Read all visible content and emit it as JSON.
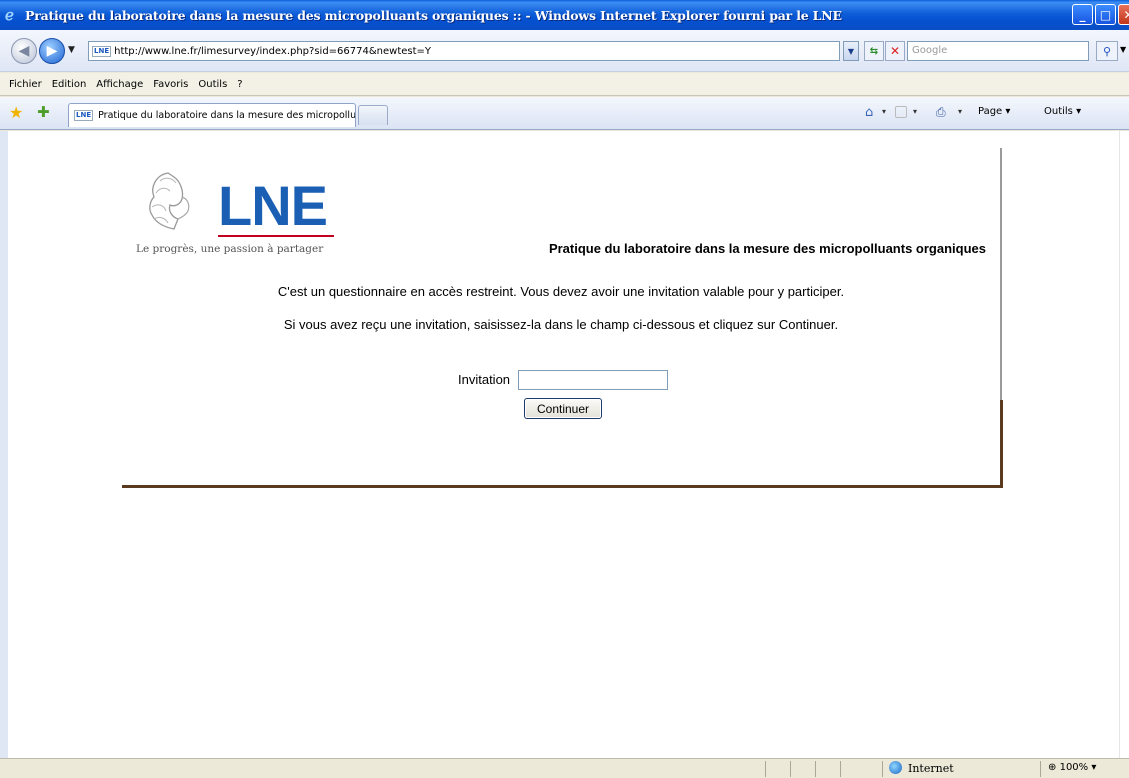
{
  "window": {
    "title": "Pratique du laboratoire dans la mesure des micropolluants organiques :: - Windows Internet Explorer fourni par le LNE",
    "min": "_",
    "max": "□",
    "close": "✕"
  },
  "address": {
    "favicon": "LNE",
    "url": "http://www.lne.fr/limesurvey/index.php?sid=66774&newtest=Y"
  },
  "search": {
    "placeholder": "Google"
  },
  "menu": {
    "items": [
      "Fichier",
      "Edition",
      "Affichage",
      "Favoris",
      "Outils",
      "?"
    ]
  },
  "tabs": {
    "favicon": "LNE",
    "active_title": "Pratique du laboratoire dans la mesure des micropollu..."
  },
  "commandbar": {
    "page_label": "Page ▾",
    "tools_label": "Outils ▾"
  },
  "page": {
    "logo_text": "LNE",
    "logo_tagline": "Le progrès, une passion à partager",
    "survey_title": "Pratique du laboratoire dans la mesure des micropolluants organiques",
    "message1": "C'est un questionnaire en accès restreint. Vous devez avoir une invitation valable pour y participer.",
    "message2": "Si vous avez reçu une invitation, saisissez-la dans le champ ci-dessous et cliquez sur Continuer.",
    "invitation_label": "Invitation",
    "invitation_value": "",
    "continue_label": "Continuer"
  },
  "status": {
    "zone": "Internet",
    "zoom": "100%"
  },
  "colors": {
    "lne_blue": "#1b5fb5",
    "lne_red": "#c2001f",
    "card_border": "#5a3a1f"
  }
}
